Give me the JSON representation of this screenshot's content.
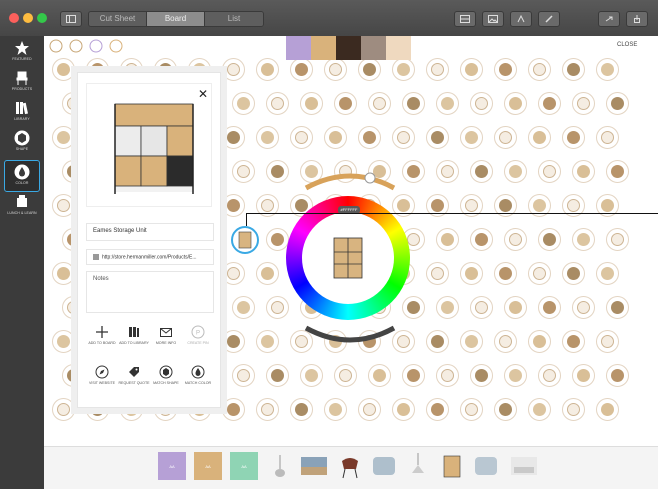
{
  "window": {
    "tabs": [
      "Cut Sheet",
      "Board",
      "List"
    ],
    "active_tab": "Board"
  },
  "sidebar": {
    "items": [
      {
        "label": "FEATURED",
        "icon": "star-icon"
      },
      {
        "label": "PRODUCTS",
        "icon": "chair-icon"
      },
      {
        "label": "LIBRARY",
        "icon": "books-icon"
      },
      {
        "label": "SHAPE",
        "icon": "hexagon-icon"
      },
      {
        "label": "COLOR",
        "icon": "drop-icon"
      },
      {
        "label": "LUNCH & LEARN",
        "icon": "lamp-icon"
      }
    ],
    "selected": "COLOR"
  },
  "palette": {
    "swatches": [
      "#b6a0d6",
      "#d9b27b",
      "#3b2a20",
      "#9e8c80",
      "#efd9bf"
    ],
    "close_label": "CLOSE"
  },
  "panel": {
    "product_name": "Eames Storage Unit",
    "url": "http://store.hermanmiller.com/Products/E...",
    "notes_placeholder": "Notes",
    "actions": [
      {
        "label": "ADD TO BOARD",
        "icon": "plus-icon"
      },
      {
        "label": "ADD TO LIBRARY",
        "icon": "library-icon"
      },
      {
        "label": "MORE INFO",
        "icon": "mail-icon"
      },
      {
        "label": "CREATE PIN",
        "icon": "pin-icon"
      },
      {
        "label": "VISIT WEBSITE",
        "icon": "compass-icon"
      },
      {
        "label": "REQUEST QUOTE",
        "icon": "tag-icon"
      },
      {
        "label": "MATCH SHAPE",
        "icon": "hexagon-icon"
      },
      {
        "label": "MATCH COLOR",
        "icon": "drop-icon"
      }
    ]
  },
  "wheel": {
    "badge": "#FFFFFF"
  },
  "tray": {
    "colors": [
      "#b6a0d6",
      "#d9b27b",
      "#8fd4b4"
    ],
    "color_labels": [
      "AA",
      "AA",
      "AA"
    ]
  },
  "accent_color": "#3aa9e4"
}
